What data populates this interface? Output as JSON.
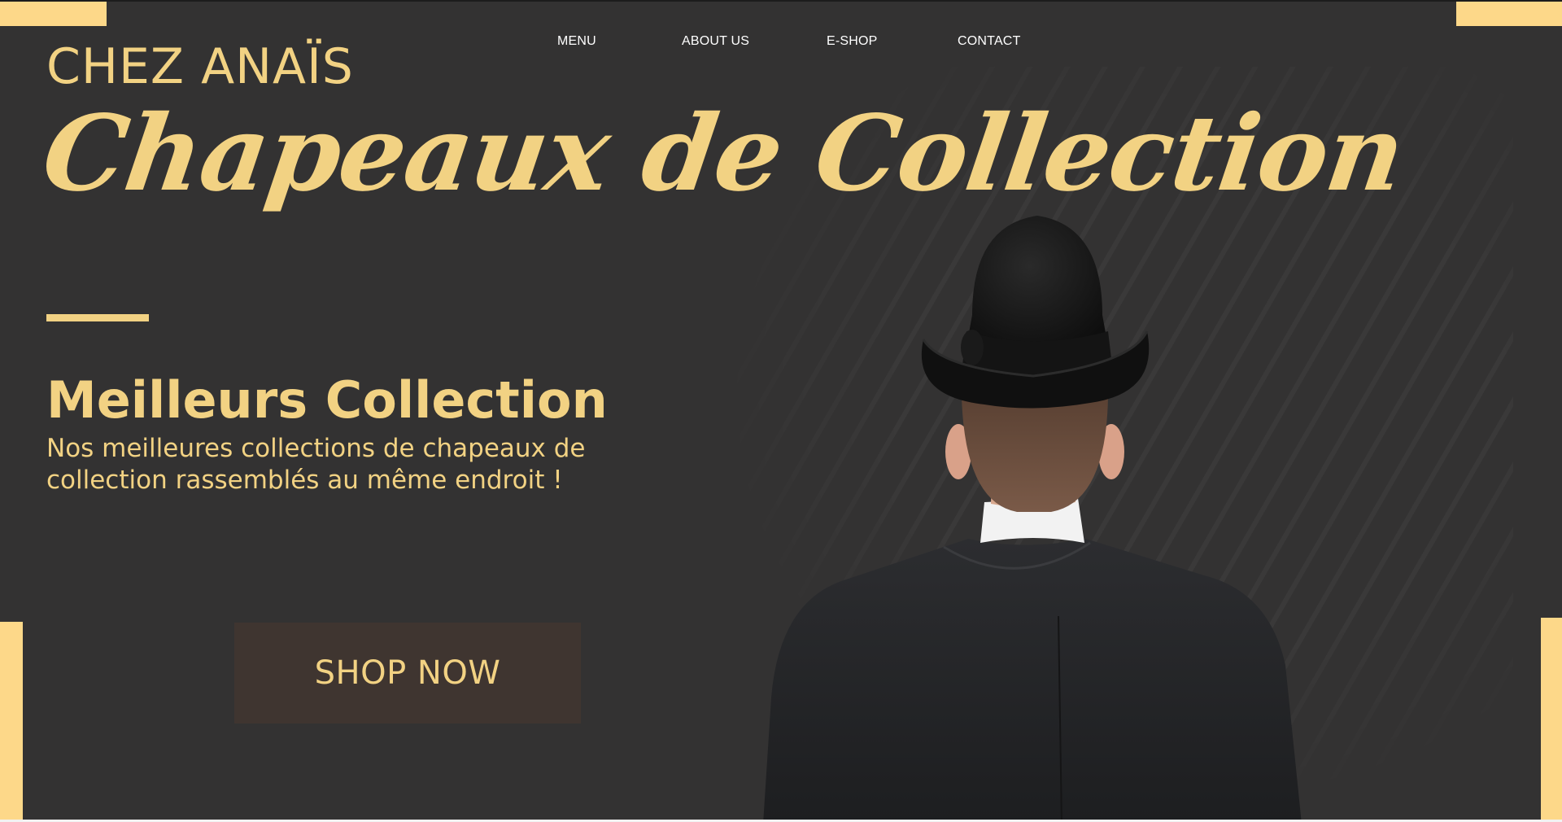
{
  "nav": {
    "items": [
      {
        "label": "MENU"
      },
      {
        "label": "ABOUT US"
      },
      {
        "label": "E-SHOP"
      },
      {
        "label": "CONTACT"
      }
    ]
  },
  "brand": "CHEZ ANAÏS",
  "hero": {
    "script_title": "Chapeaux de Collection",
    "headline": "Meilleurs Collection",
    "subtext": "Nos meilleures collections de chapeaux de collection rassemblés au même endroit !",
    "cta_label": "SHOP NOW"
  },
  "colors": {
    "background": "#333232",
    "accent": "#f2d283",
    "corner_bars": "#fdd889",
    "button_bg": "#3f3530"
  }
}
